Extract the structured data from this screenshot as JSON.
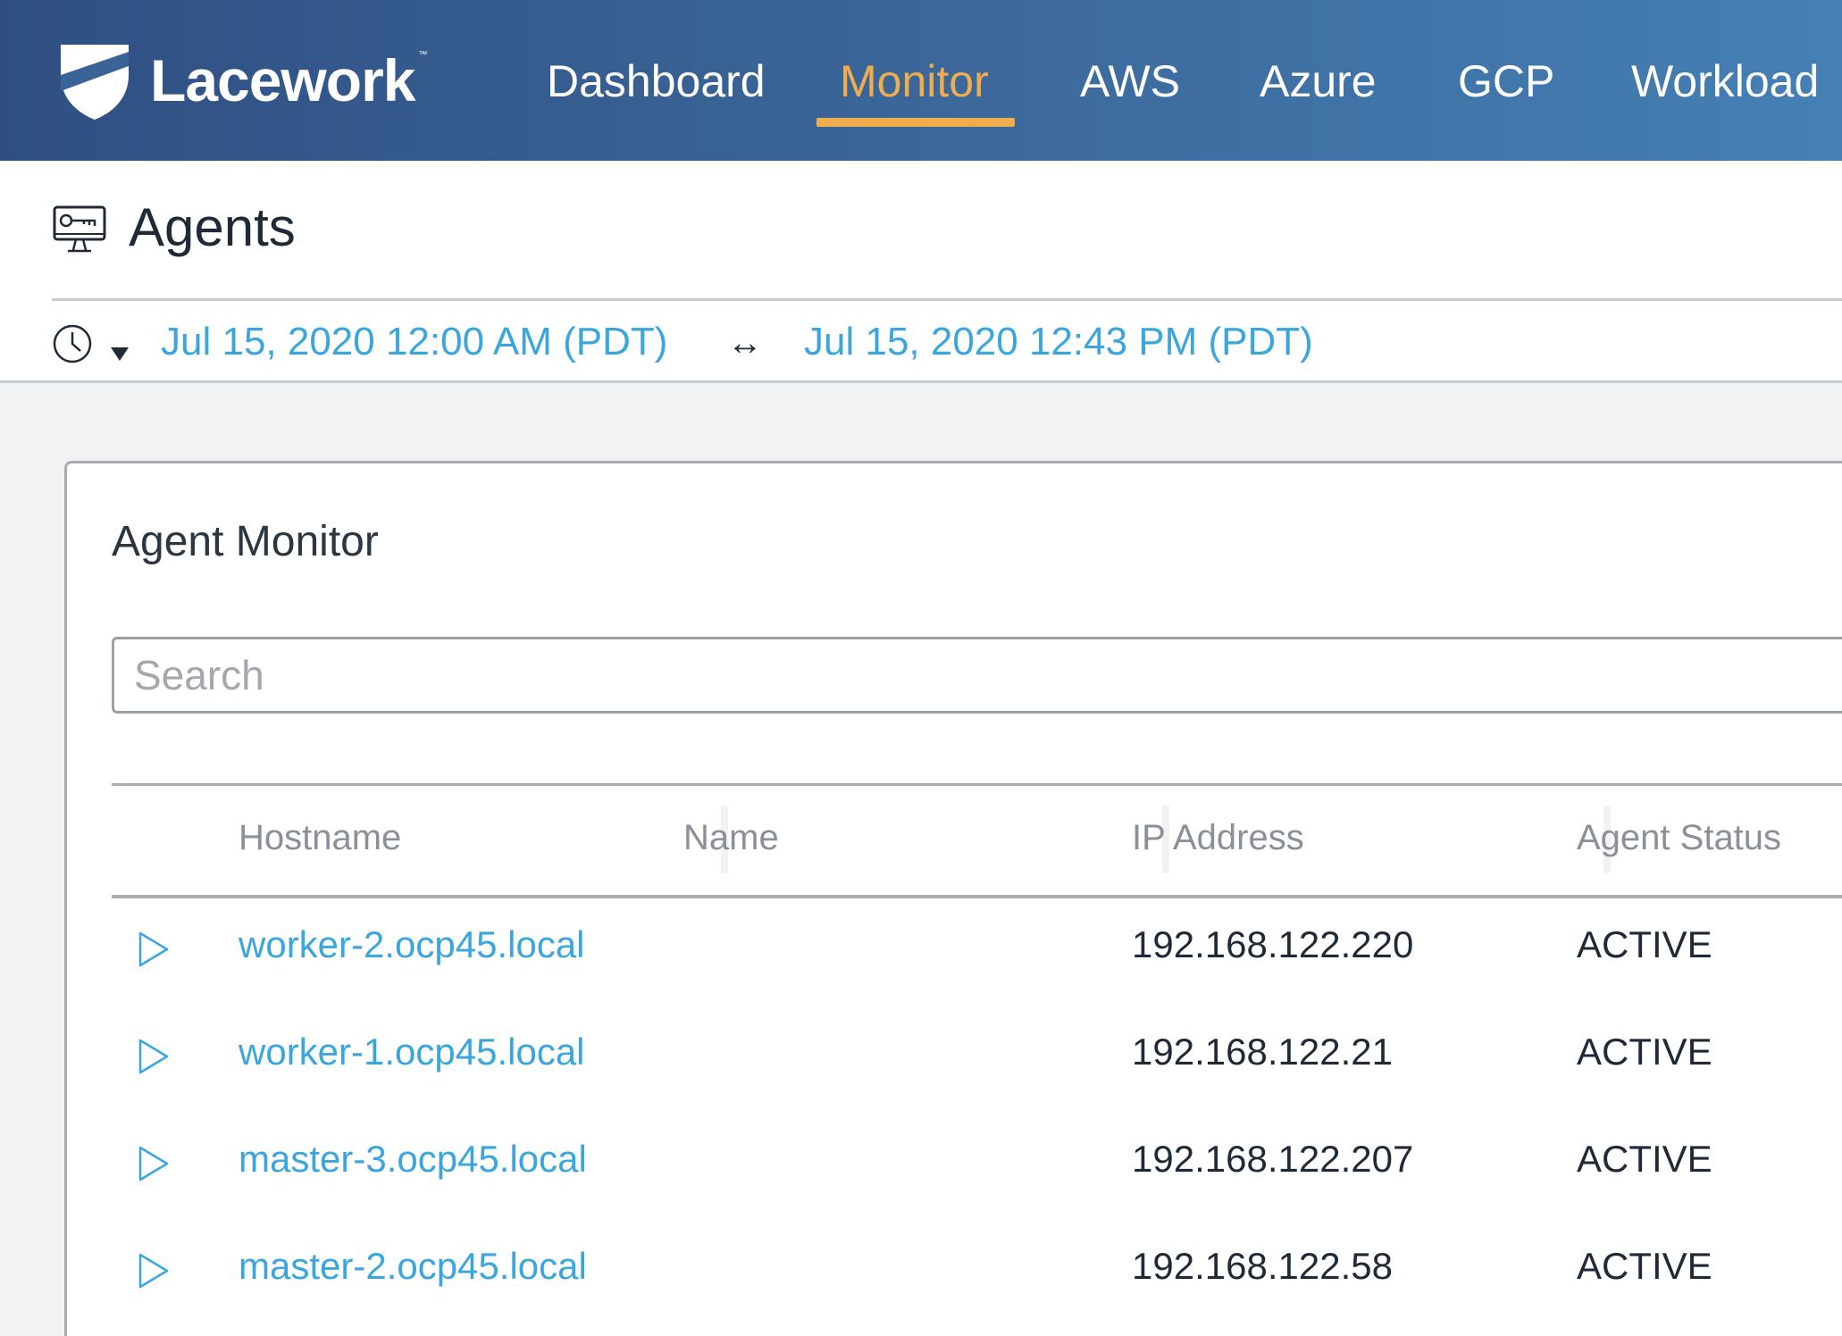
{
  "brand": {
    "name": "Lacework",
    "trademark": "™"
  },
  "nav": {
    "items": [
      {
        "label": "Dashboard"
      },
      {
        "label": "Monitor"
      },
      {
        "label": "AWS"
      },
      {
        "label": "Azure"
      },
      {
        "label": "GCP"
      },
      {
        "label": "Workload"
      }
    ],
    "active": "Monitor"
  },
  "page": {
    "title": "Agents",
    "title_icon": "monitor-key-icon"
  },
  "time_range": {
    "start": "Jul 15, 2020 12:00 AM (PDT)",
    "end": "Jul 15, 2020 12:43 PM (PDT)",
    "separator": "↔",
    "clock_icon": "clock-icon",
    "dropdown_icon": "caret-down-icon"
  },
  "agent_monitor": {
    "title": "Agent Monitor",
    "search": {
      "placeholder": "Search",
      "value": ""
    },
    "columns": [
      "Hostname",
      "Name",
      "IP Address",
      "Agent Status"
    ],
    "rows": [
      {
        "hostname": "worker-2.ocp45.local",
        "name": "",
        "ip": "192.168.122.220",
        "status": "ACTIVE"
      },
      {
        "hostname": "worker-1.ocp45.local",
        "name": "",
        "ip": "192.168.122.21",
        "status": "ACTIVE"
      },
      {
        "hostname": "master-3.ocp45.local",
        "name": "",
        "ip": "192.168.122.207",
        "status": "ACTIVE"
      },
      {
        "hostname": "master-2.ocp45.local",
        "name": "",
        "ip": "192.168.122.58",
        "status": "ACTIVE"
      }
    ]
  },
  "colors": {
    "nav_gradient_start": "#2f4f82",
    "nav_gradient_end": "#4580b4",
    "active_accent": "#f0ad4e",
    "link": "#3ba6dd",
    "text": "#1f2a36"
  }
}
